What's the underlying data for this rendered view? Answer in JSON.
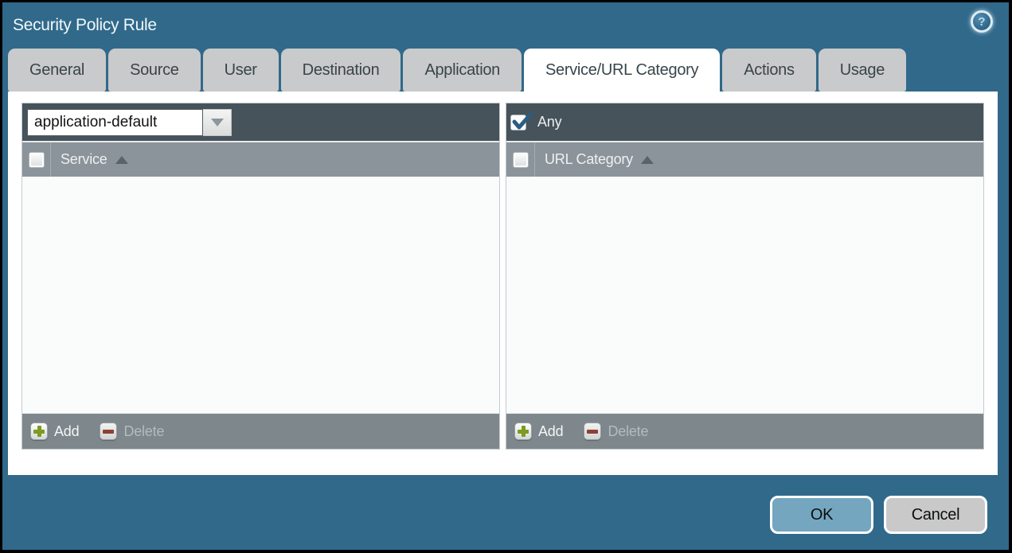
{
  "window": {
    "title": "Security Policy Rule",
    "help_glyph": "?"
  },
  "tabs": [
    {
      "label": "General",
      "active": false
    },
    {
      "label": "Source",
      "active": false
    },
    {
      "label": "User",
      "active": false
    },
    {
      "label": "Destination",
      "active": false
    },
    {
      "label": "Application",
      "active": false
    },
    {
      "label": "Service/URL Category",
      "active": true
    },
    {
      "label": "Actions",
      "active": false
    },
    {
      "label": "Usage",
      "active": false
    }
  ],
  "service_panel": {
    "dropdown": {
      "value": "application-default"
    },
    "header": {
      "label": "Service",
      "checked": false,
      "sorted": "asc"
    },
    "rows": [],
    "footer": {
      "add_label": "Add",
      "delete_label": "Delete",
      "add_enabled": true,
      "delete_enabled": false
    }
  },
  "url_category_panel": {
    "any": {
      "label": "Any",
      "checked": true
    },
    "header": {
      "label": "URL Category",
      "checked": false,
      "sorted": "asc"
    },
    "rows": [],
    "footer": {
      "add_label": "Add",
      "delete_label": "Delete",
      "add_enabled": true,
      "delete_enabled": false
    }
  },
  "dialog_actions": {
    "ok_label": "OK",
    "cancel_label": "Cancel"
  },
  "colors": {
    "dialog_background": "#31698a",
    "panel_toolbar": "#46535a",
    "column_header": "#8b949a",
    "panel_footer": "#7e878c",
    "tab_inactive": "#c9cacb",
    "tab_active": "#ffffff",
    "ok_button": "#74a6bf",
    "cancel_button": "#c9c9c9",
    "add_icon_green": "#7d9b21",
    "delete_icon_red": "#8e4133",
    "checkmark_blue": "#2a5d84"
  }
}
